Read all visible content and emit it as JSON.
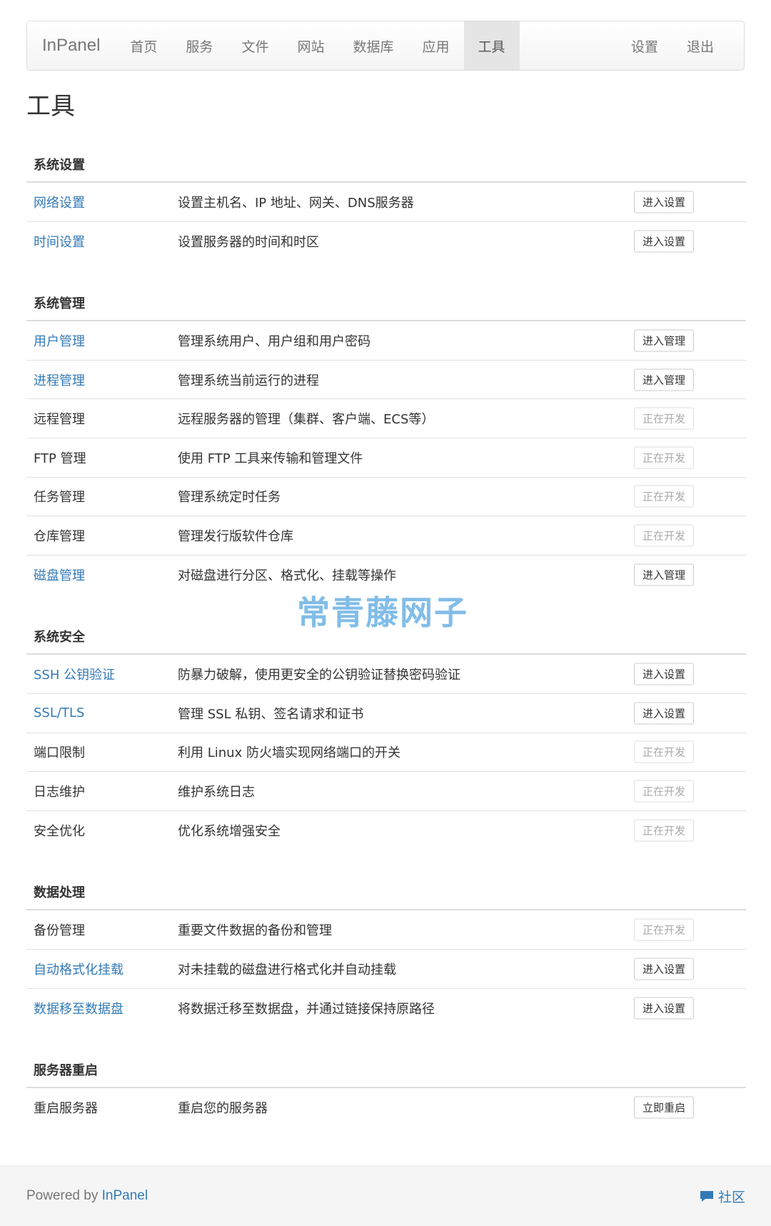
{
  "navbar": {
    "brand": "InPanel",
    "left_items": [
      {
        "id": "home",
        "label": "首页",
        "active": false
      },
      {
        "id": "service",
        "label": "服务",
        "active": false
      },
      {
        "id": "file",
        "label": "文件",
        "active": false
      },
      {
        "id": "site",
        "label": "网站",
        "active": false
      },
      {
        "id": "database",
        "label": "数据库",
        "active": false
      },
      {
        "id": "app",
        "label": "应用",
        "active": false
      },
      {
        "id": "tools",
        "label": "工具",
        "active": true
      }
    ],
    "right_items": [
      {
        "id": "settings",
        "label": "设置"
      },
      {
        "id": "logout",
        "label": "退出"
      }
    ]
  },
  "page_title": "工具",
  "sections": [
    {
      "title": "系统设置",
      "rows": [
        {
          "name": "网络设置",
          "link": true,
          "desc": "设置主机名、IP 地址、网关、DNS服务器",
          "action": "进入设置",
          "enabled": true
        },
        {
          "name": "时间设置",
          "link": true,
          "desc": "设置服务器的时间和时区",
          "action": "进入设置",
          "enabled": true
        }
      ]
    },
    {
      "title": "系统管理",
      "rows": [
        {
          "name": "用户管理",
          "link": true,
          "desc": "管理系统用户、用户组和用户密码",
          "action": "进入管理",
          "enabled": true
        },
        {
          "name": "进程管理",
          "link": true,
          "desc": "管理系统当前运行的进程",
          "action": "进入管理",
          "enabled": true
        },
        {
          "name": "远程管理",
          "link": false,
          "desc": "远程服务器的管理（集群、客户端、ECS等）",
          "action": "正在开发",
          "enabled": false
        },
        {
          "name": "FTP 管理",
          "link": false,
          "desc": "使用 FTP 工具来传输和管理文件",
          "action": "正在开发",
          "enabled": false
        },
        {
          "name": "任务管理",
          "link": false,
          "desc": "管理系统定时任务",
          "action": "正在开发",
          "enabled": false
        },
        {
          "name": "仓库管理",
          "link": false,
          "desc": "管理发行版软件仓库",
          "action": "正在开发",
          "enabled": false
        },
        {
          "name": "磁盘管理",
          "link": true,
          "desc": "对磁盘进行分区、格式化、挂载等操作",
          "action": "进入管理",
          "enabled": true
        }
      ]
    },
    {
      "title": "系统安全",
      "rows": [
        {
          "name": "SSH 公钥验证",
          "link": true,
          "desc": "防暴力破解，使用更安全的公钥验证替换密码验证",
          "action": "进入设置",
          "enabled": true
        },
        {
          "name": "SSL/TLS",
          "link": true,
          "desc": "管理 SSL 私钥、签名请求和证书",
          "action": "进入设置",
          "enabled": true
        },
        {
          "name": "端口限制",
          "link": false,
          "desc": "利用 Linux 防火墙实现网络端口的开关",
          "action": "正在开发",
          "enabled": false
        },
        {
          "name": "日志维护",
          "link": false,
          "desc": "维护系统日志",
          "action": "正在开发",
          "enabled": false
        },
        {
          "name": "安全优化",
          "link": false,
          "desc": "优化系统增强安全",
          "action": "正在开发",
          "enabled": false
        }
      ]
    },
    {
      "title": "数据处理",
      "rows": [
        {
          "name": "备份管理",
          "link": false,
          "desc": "重要文件数据的备份和管理",
          "action": "正在开发",
          "enabled": false
        },
        {
          "name": "自动格式化挂载",
          "link": true,
          "desc": "对未挂载的磁盘进行格式化并自动挂载",
          "action": "进入设置",
          "enabled": true
        },
        {
          "name": "数据移至数据盘",
          "link": true,
          "desc": "将数据迁移至数据盘，并通过链接保持原路径",
          "action": "进入设置",
          "enabled": true
        }
      ]
    },
    {
      "title": "服务器重启",
      "rows": [
        {
          "name": "重启服务器",
          "link": false,
          "desc": "重启您的服务器",
          "action": "立即重启",
          "enabled": true
        }
      ]
    }
  ],
  "watermark": "常青藤网子",
  "footer": {
    "powered_by": "Powered by ",
    "brand_link": "InPanel",
    "community": "社区",
    "community_icon": "chat-bubble-icon"
  },
  "colors": {
    "link": "#337ab7",
    "active_nav_bg": "#e5e5e5",
    "disabled_text": "#aaaaaa"
  }
}
